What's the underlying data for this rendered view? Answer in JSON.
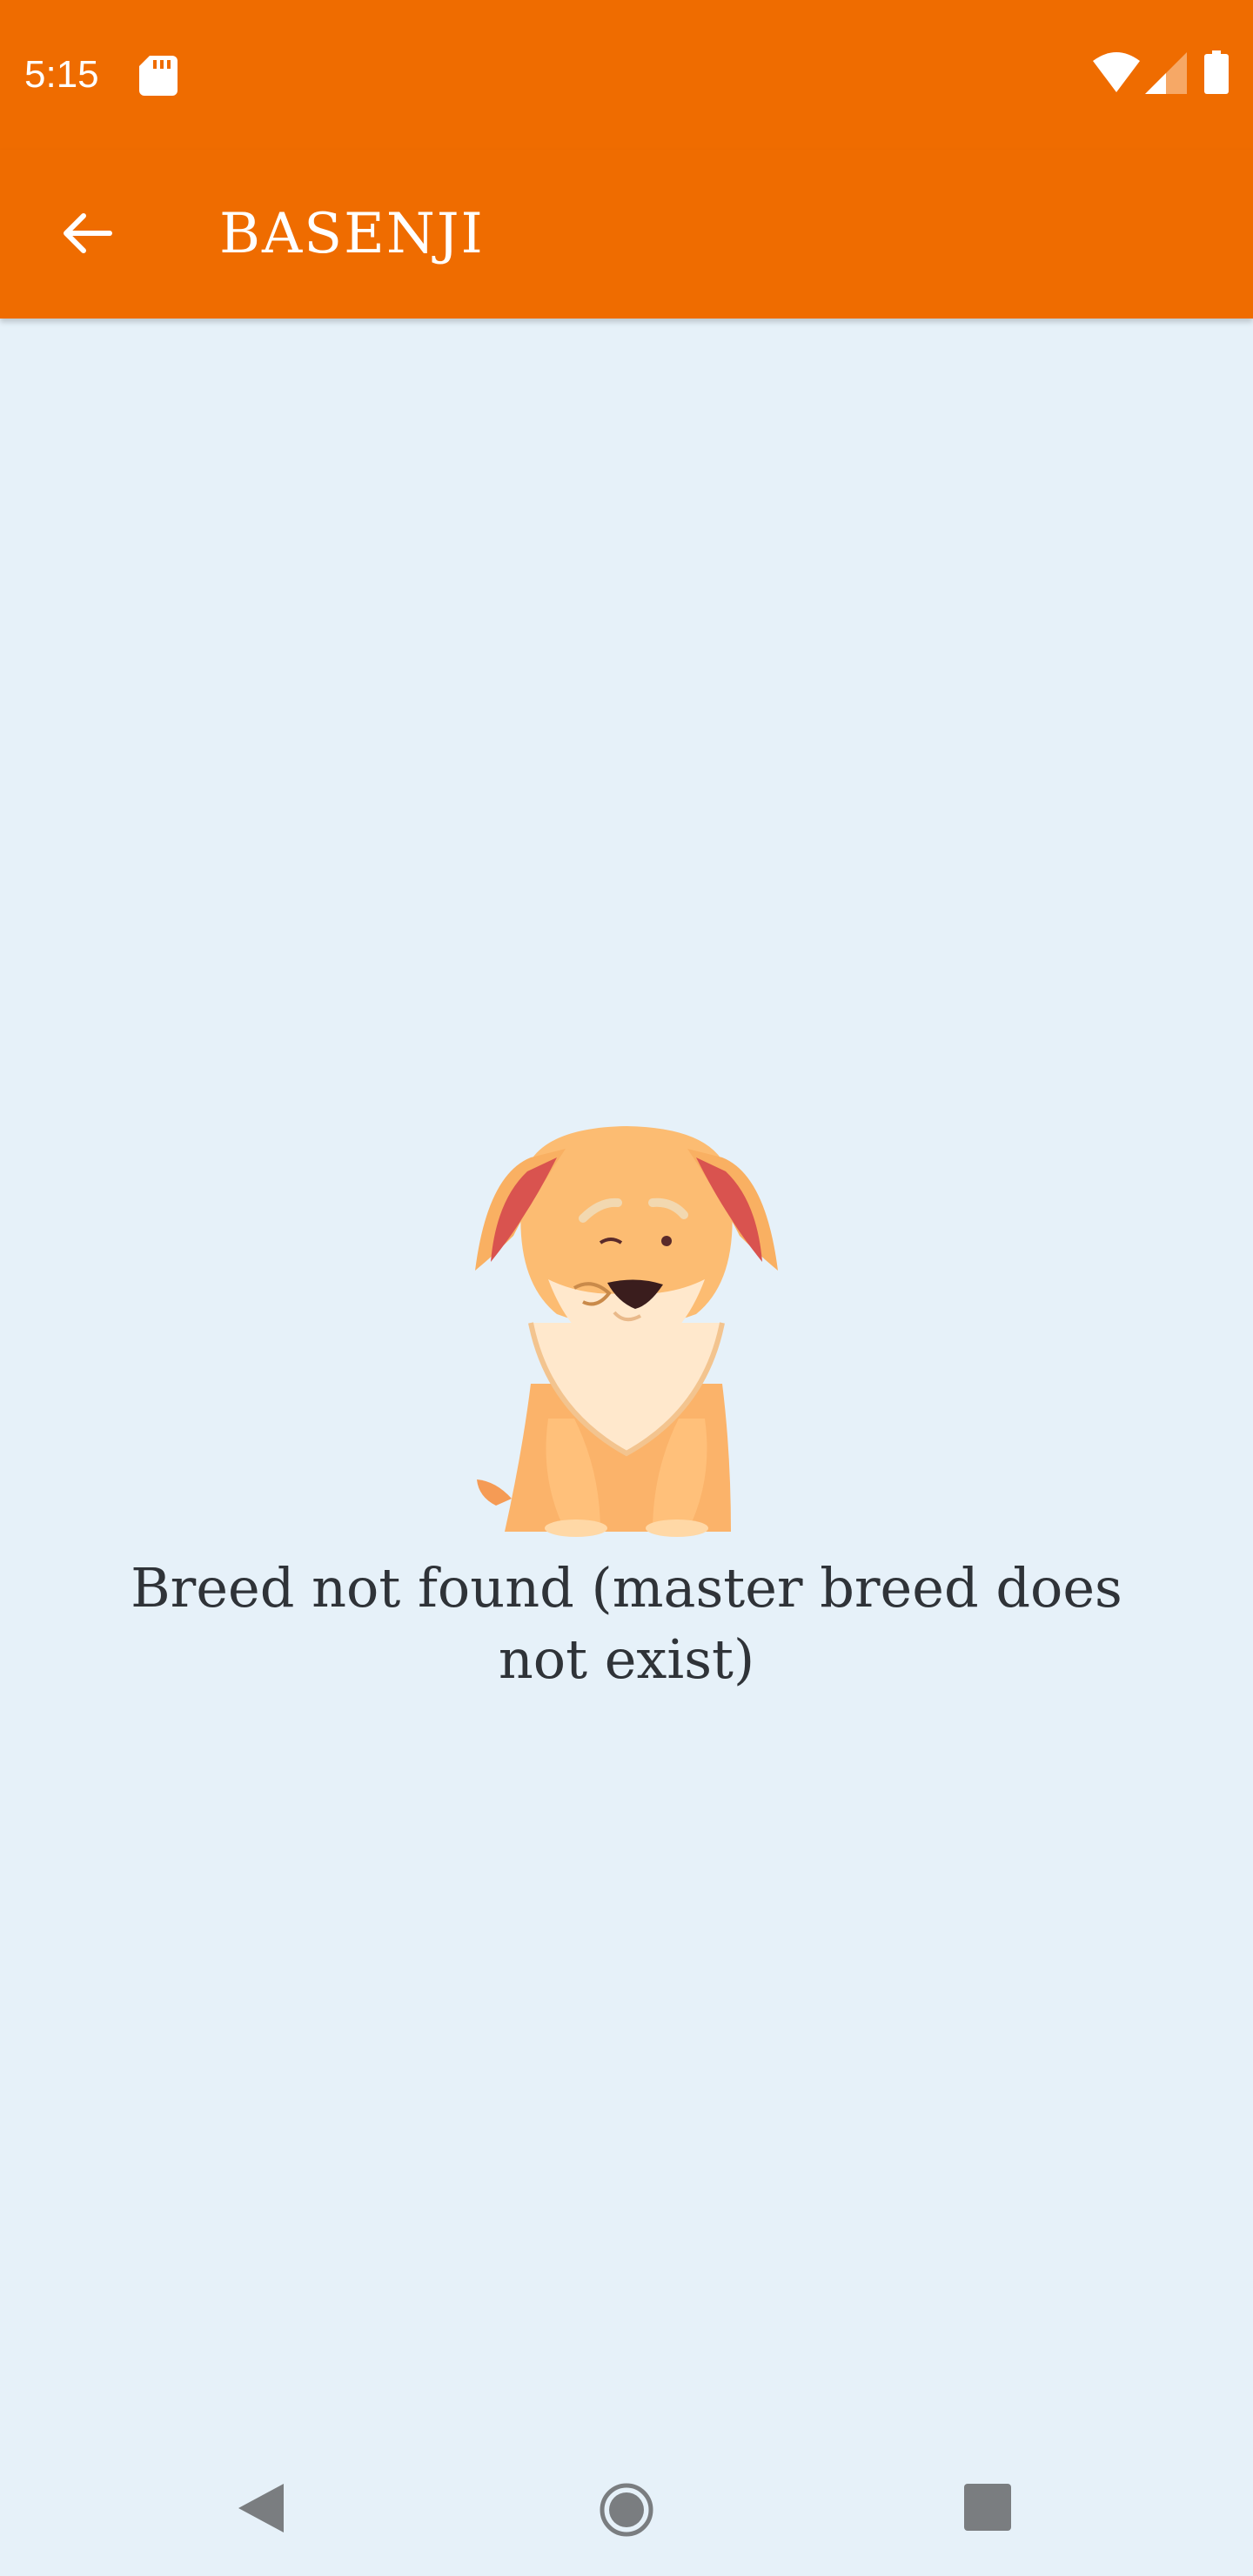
{
  "status_bar": {
    "time": "5:15",
    "icons": [
      "sd-card-icon",
      "wifi-icon",
      "cell-signal-icon",
      "battery-icon"
    ]
  },
  "toolbar": {
    "title": "BASENJI",
    "back_icon": "arrow-back-icon"
  },
  "empty_state": {
    "illustration": "sad-dog-illustration",
    "message": "Breed not found (master breed does not exist)"
  },
  "nav_bar": {
    "icons": [
      "nav-back-icon",
      "nav-home-icon",
      "nav-recents-icon"
    ]
  },
  "colors": {
    "primary": "#ef6c00",
    "background": "#e6f1f9",
    "text": "#2f3338"
  }
}
